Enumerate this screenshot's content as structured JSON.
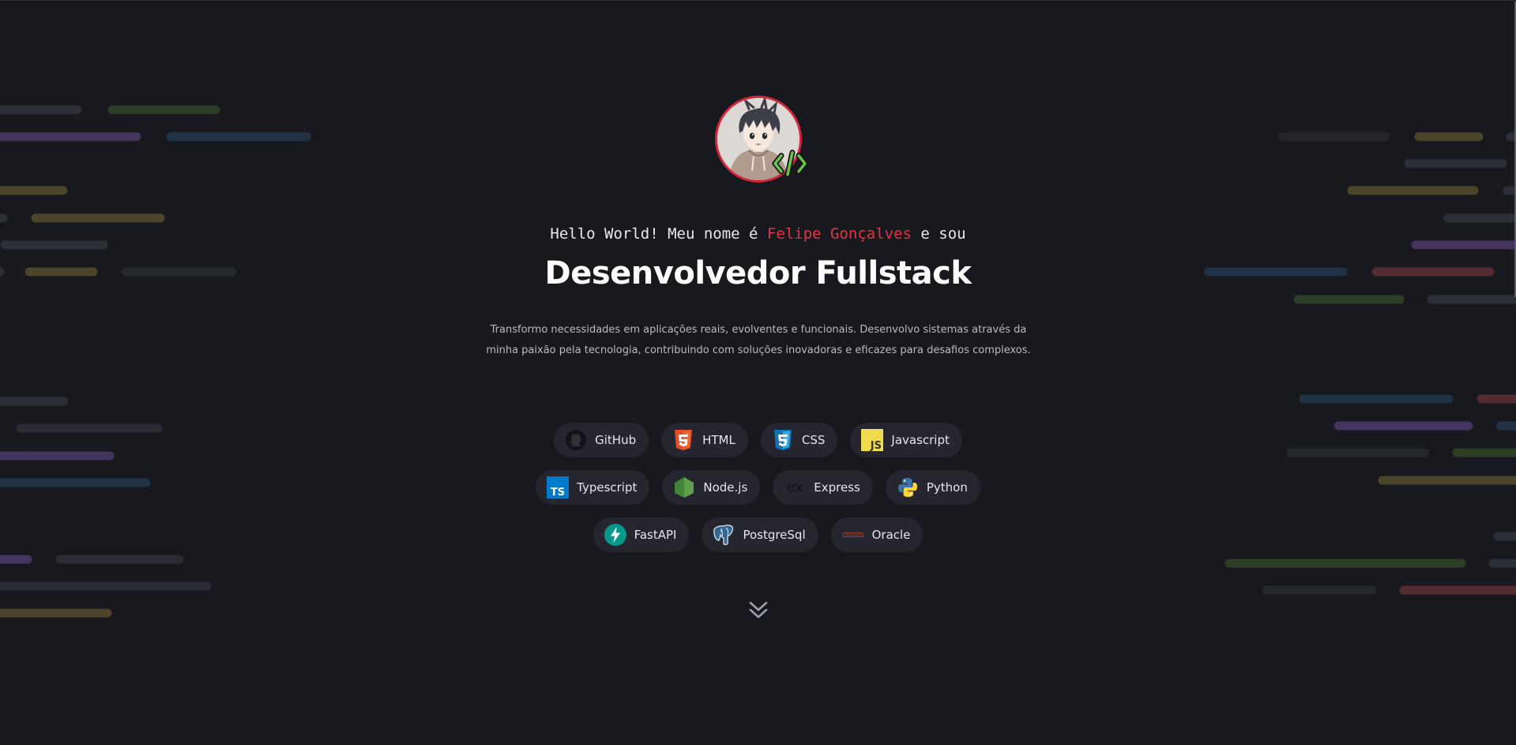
{
  "hero": {
    "greeting_prefix": "Hello World! Meu nome é ",
    "name": "Felipe Gonçalves",
    "greeting_suffix": " e sou",
    "title": "Desenvolvedor Fullstack",
    "description_line1": "Transformo necessidades em aplicações reais, evolventes e funcionais. Desenvolvo sistemas através da",
    "description_line2": "minha paixão pela tecnologia, contribuindo com soluções inovadoras e eficazes para desafios complexos."
  },
  "techs": {
    "row1": [
      "GitHub",
      "HTML",
      "CSS",
      "Javascript"
    ],
    "row2": [
      "Typescript",
      "Node.js",
      "Express",
      "Python"
    ],
    "row3": [
      "FastAPI",
      "PostgreSql",
      "Oracle"
    ]
  },
  "icons": {
    "github": "github-icon",
    "html": "html5-icon",
    "css": "css3-icon",
    "javascript": "javascript-icon",
    "typescript": "typescript-icon",
    "nodejs": "nodejs-icon",
    "express": "express-icon",
    "python": "python-icon",
    "fastapi": "fastapi-icon",
    "postgresql": "postgresql-icon",
    "oracle": "oracle-icon",
    "scroll": "chevron-double-down-icon",
    "avatar_badge": "code-brackets-icon"
  },
  "colors": {
    "background": "#18191f",
    "accent_name": "#e23545",
    "avatar_border": "#d2263b",
    "chip_bg": "#25262f",
    "code_badge": "#6cc04a"
  }
}
